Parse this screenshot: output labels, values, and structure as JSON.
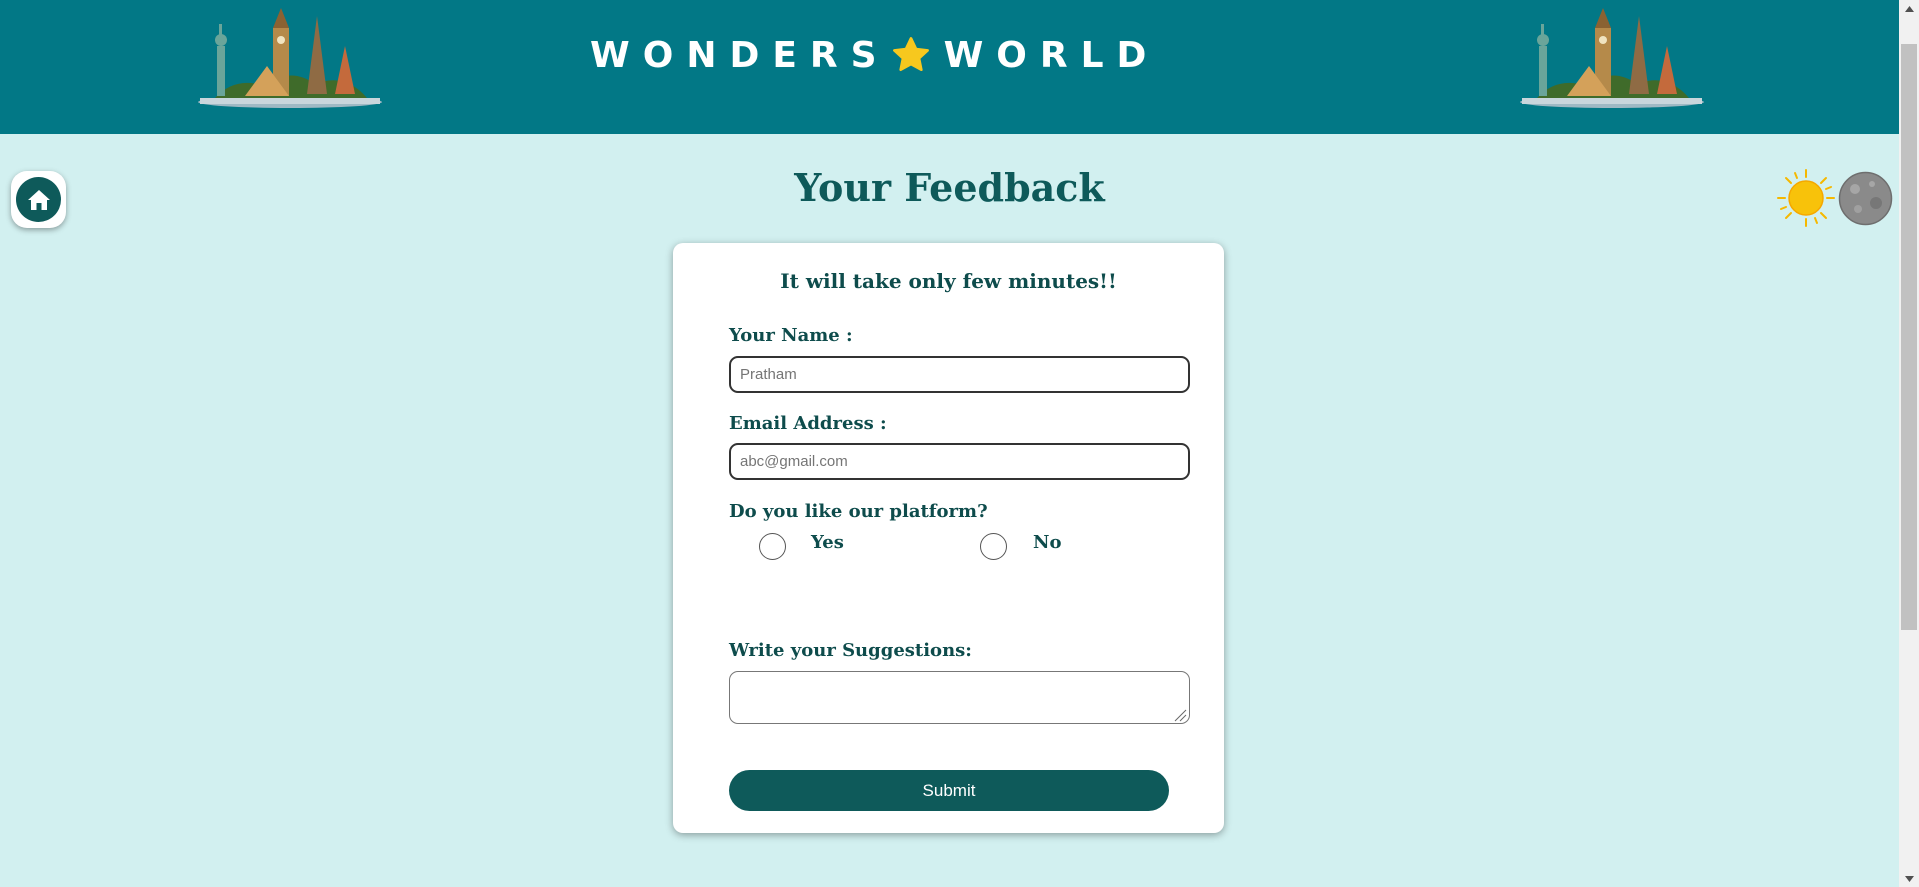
{
  "header": {
    "brand_left": "WONDERS",
    "brand_right": "WORLD",
    "background_color": "#027886",
    "star_color": "#f7c81e"
  },
  "nav": {
    "home_icon": "home-icon",
    "sun_icon": "sun-icon",
    "moon_icon": "moon-icon"
  },
  "page": {
    "title": "Your Feedback",
    "background_color": "#d2f0f0"
  },
  "form": {
    "subtitle": "It will take only few minutes!!",
    "name_label": "Your Name :",
    "name_placeholder": "Pratham",
    "email_label": "Email Address :",
    "email_placeholder": "abc@gmail.com",
    "question_label": "Do you like our platform?",
    "option_yes": "Yes",
    "option_no": "No",
    "suggestions_label": "Write your Suggestions:",
    "submit_label": "Submit",
    "accent_color": "#0e5a5a"
  }
}
